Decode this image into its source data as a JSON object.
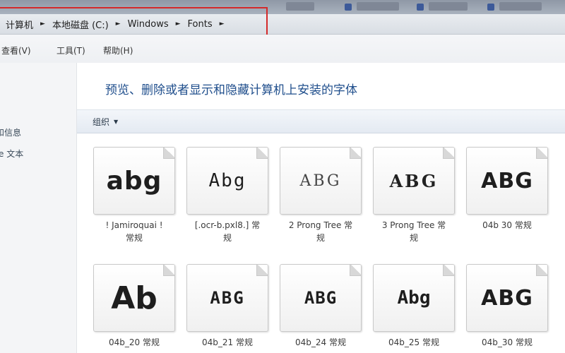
{
  "address": {
    "crumbs": [
      "计算机",
      "本地磁盘 (C:)",
      "Windows",
      "Fonts"
    ],
    "highlight_color": "#d42a2a"
  },
  "menu": {
    "items": [
      "查看(V)",
      "工具(T)",
      "帮助(H)"
    ]
  },
  "sidebar": {
    "items": [
      "和信息",
      "e 文本"
    ]
  },
  "main": {
    "heading": "预览、删除或者显示和隐藏计算机上安装的字体",
    "organize_label": "组织",
    "fonts": [
      {
        "sample": "abg",
        "label_line1": "! Jamiroquai !",
        "label_line2": "常规"
      },
      {
        "sample": "Abg",
        "label_line1": "[.ocr-b.pxl8.] 常",
        "label_line2": "规"
      },
      {
        "sample": "ABG",
        "label_line1": "2 Prong Tree 常",
        "label_line2": "规"
      },
      {
        "sample": "ABG",
        "label_line1": "3 Prong Tree 常",
        "label_line2": "规"
      },
      {
        "sample": "ABG",
        "label_line1": "04b 30 常规",
        "label_line2": ""
      },
      {
        "sample": "Ab",
        "label_line1": "04b_20 常规",
        "label_line2": ""
      },
      {
        "sample": "ABG",
        "label_line1": "04b_21 常规",
        "label_line2": ""
      },
      {
        "sample": "ABG",
        "label_line1": "04b_24 常规",
        "label_line2": ""
      },
      {
        "sample": "Abg",
        "label_line1": "04b_25 常规",
        "label_line2": ""
      },
      {
        "sample": "ABG",
        "label_line1": "04b_30 常规",
        "label_line2": ""
      }
    ]
  }
}
